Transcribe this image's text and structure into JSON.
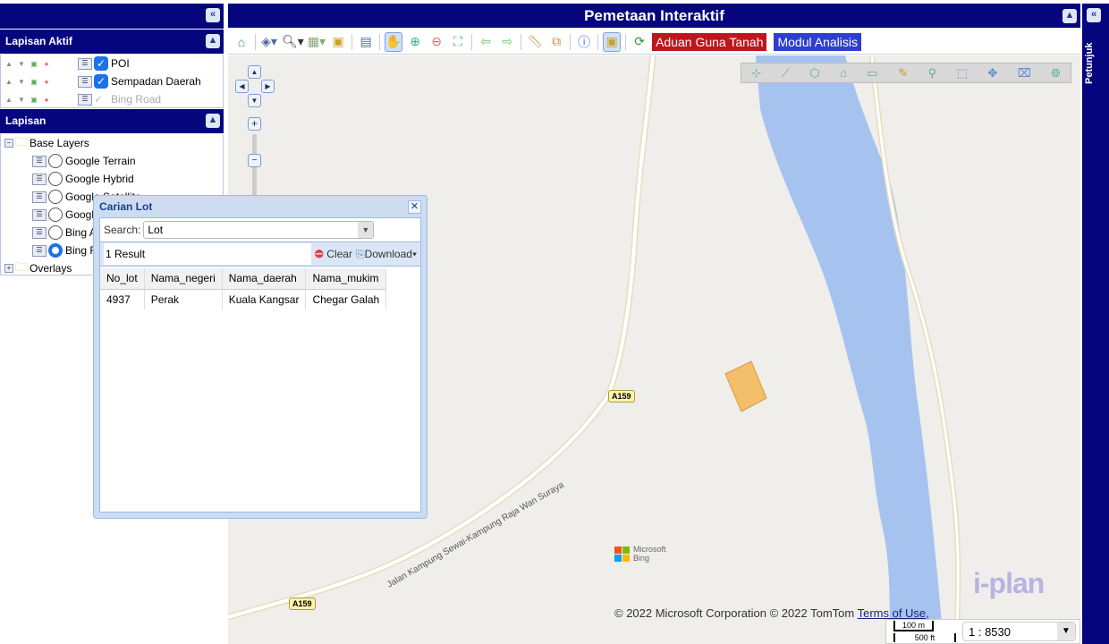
{
  "app": {
    "title": "Pemetaan Interaktif",
    "right_panel_label": "Petunjuk"
  },
  "left": {
    "active_header": "Lapisan Aktif",
    "active_layers": [
      {
        "label": "POI",
        "checked": true
      },
      {
        "label": "Sempadan Daerah",
        "checked": true
      },
      {
        "label": "Bing Road",
        "checked": false
      }
    ],
    "layers_header": "Lapisan",
    "base_group": "Base Layers",
    "base_layers": [
      {
        "label": "Google Terrain",
        "selected": false
      },
      {
        "label": "Google Hybrid",
        "selected": false
      },
      {
        "label": "Google Satellite",
        "selected": false
      },
      {
        "label": "Google",
        "selected": false
      },
      {
        "label": "Bing A",
        "selected": false
      },
      {
        "label": "Bing R",
        "selected": true
      }
    ],
    "overlays_group": "Overlays"
  },
  "toolbar": {
    "aduan_label": "Aduan Guna Tanah",
    "modul_label": "Modul Analisis",
    "aduan_color": "#c0151c",
    "modul_color": "#2e3fcf"
  },
  "dialog": {
    "title": "Carian Lot",
    "search_label": "Search:",
    "search_value": "Lot",
    "result_count": "1 Result",
    "clear_label": "Clear",
    "download_label": "Download",
    "columns": [
      "No_lot",
      "Nama_negeri",
      "Nama_daerah",
      "Nama_mukim"
    ],
    "rows": [
      [
        "4937",
        "Perak",
        "Kuala Kangsar",
        "Chegar Galah"
      ]
    ]
  },
  "map": {
    "road_label_1": "A159",
    "road_label_2": "A159",
    "road_name": "Jalan Kampung Sewai-Kampung Raja Wan Suraya",
    "bing_logo": "Microsoft Bing",
    "copyright": "© 2022 Microsoft Corporation © 2022 TomTom ",
    "terms": "Terms of Use",
    "scale_m": "100 m",
    "scale_ft": "500 ft",
    "scale_value": "1 : 8530",
    "watermark": "i-plan"
  }
}
